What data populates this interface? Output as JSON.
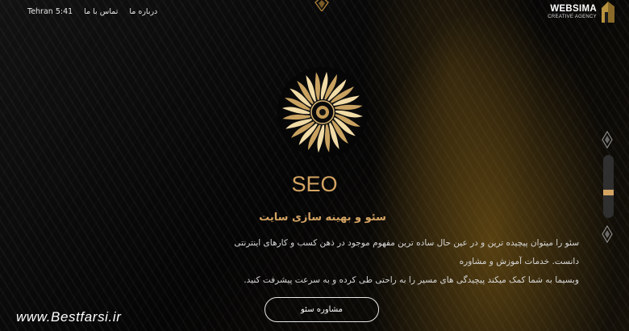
{
  "nav": {
    "time": "Tehran 5:41",
    "contact": "تماس با ما",
    "about": "درباره ما"
  },
  "logo": {
    "title": "WEBSIMA",
    "subtitle": "CREATIVE AGENCY"
  },
  "hero": {
    "title": "SEO",
    "subtitle": "سئو و بهینه سازی سایت",
    "description_line1": "سئو را میتوان پیچیده ترین و در عین حال ساده ترین مفهوم موجود در ذهن کسب و کارهای اینترنتی دانست. خدمات آموزش و مشاوره",
    "description_line2": "وبسیما به شما کمک میکند پیچیدگی های مسیر را به راحتی طی کرده و به سرعت پیشرفت کنید.",
    "button_label": "مشاوره سئو"
  },
  "watermark": "www.Bestfarsi.ir",
  "scroll": {
    "progress": 0.6
  },
  "colors": {
    "accent": "#d4a463",
    "background": "#0b0b0b"
  },
  "icons": [
    "websima-logo-icon",
    "gold-emblem-icon",
    "sun-emblem-icon",
    "scroll-up-icon",
    "scroll-down-icon"
  ]
}
